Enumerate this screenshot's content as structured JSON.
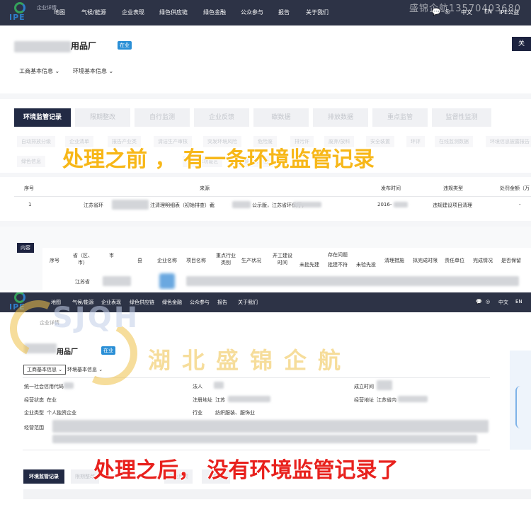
{
  "watermark_top": "盛锦企航13570403680",
  "top": {
    "nav": {
      "logo_text": "IPE",
      "breadcrumb": "企业详情",
      "items": [
        "地图",
        "气候/能源",
        "企业表现",
        "绿色供应链",
        "绿色金融",
        "公众参与",
        "报告",
        "关于我们"
      ],
      "lang": [
        "中文",
        "EN",
        "IPE公益"
      ]
    },
    "company_name": "用品厂",
    "status_badge": "在业",
    "dropdowns": [
      "工商基本信息",
      "环境基本信息"
    ],
    "right_button": "关",
    "tabs": [
      "环境监管记录",
      "限期整改",
      "自行监测",
      "企业反馈",
      "碳数据",
      "排放数据",
      "重点监管",
      "监督性监测"
    ],
    "chips_row1": [
      "自动排放分级",
      "企业清单",
      "报告产业类",
      "清洁生产审核",
      "突发环境风险",
      "危险废",
      "排污许",
      "废弃/放科",
      "安全装置",
      "环评",
      "在线监测数据",
      "环境信息披露报告"
    ],
    "chips_row2": [
      "绿色信息",
      "",
      "",
      "",
      "排污/水功能区",
      "节能环保行业"
    ],
    "caption_before": "处理之前 ， 有一条环境监管记录",
    "table": {
      "headers": [
        "序号",
        "来源",
        "发布时间",
        "违规类型",
        "处罚金额（万"
      ],
      "rows": [
        {
          "no": "1",
          "source_a": "江苏省环",
          "source_b": "注清理明细表（初始排查）截",
          "source_c": "公示版，江苏省环保厅，",
          "date": "2016-",
          "type": "违规建设项目清理"
        }
      ]
    },
    "content": {
      "label": "内容",
      "headers": [
        "序号",
        "省（区、市）",
        "市",
        "县",
        "企业名称",
        "项目名称",
        "重点行业类别",
        "生产状况",
        "开工建设时间",
        "存在问题",
        "未批先建",
        "批建不符",
        "未验先投",
        "清理措施",
        "拟完成时限",
        "责任单位",
        "完成情况",
        "是否保留"
      ],
      "province": "江苏省"
    }
  },
  "bottom": {
    "nav": {
      "logo_text": "IPE",
      "breadcrumb": "企业详情",
      "items": [
        "地图",
        "气候/能源",
        "企业表现",
        "绿色供应链",
        "绿色金融",
        "公众参与",
        "报告",
        "关于我们"
      ],
      "lang": [
        "中文",
        "EN"
      ]
    },
    "company_name": "用品厂",
    "status_badge": "在业",
    "dropdowns": [
      "工商基本信息",
      "环境基本信息"
    ],
    "info": {
      "credit_code_label": "统一社会信用代码",
      "legal_label": "法人",
      "founded_label": "成立时间",
      "status_label": "经营状态",
      "status_value": "在业",
      "reg_addr_label": "注册地址",
      "reg_addr_value": "江苏",
      "biz_addr_label": "经营地址",
      "biz_addr_value": "江苏省内",
      "type_label": "企业类型",
      "type_value": "个人独资企业",
      "industry_label": "行业",
      "industry_value": "纺织服装、服饰业",
      "scope_label": "经营范围"
    },
    "tab_active": "环境监管记录",
    "chips": [
      "限期整改",
      "",
      "",
      "企业反馈",
      "碳数据"
    ],
    "caption_after": "处理之后， 没有环境监管记录了"
  },
  "overlay": {
    "letters": "SJQH",
    "cn": "湖北盛锦企航"
  }
}
